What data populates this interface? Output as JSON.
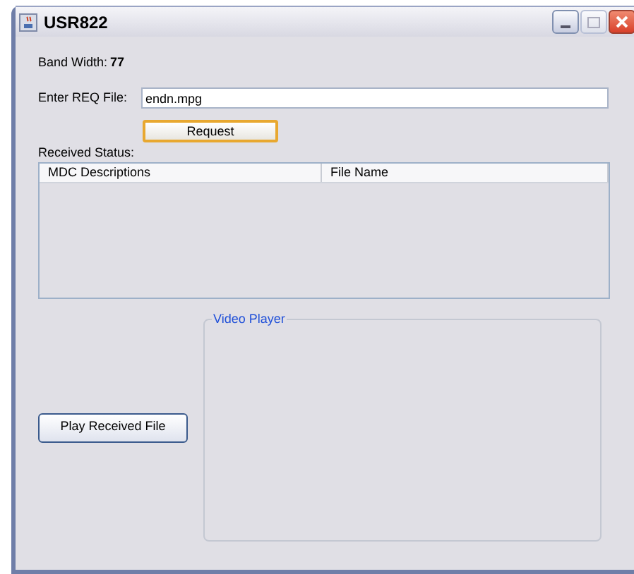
{
  "window": {
    "title": "USR822"
  },
  "bandwidth": {
    "label": "Band Width:",
    "value": "77"
  },
  "request_file": {
    "label": "Enter REQ File:",
    "value": "endn.mpg"
  },
  "request_button": {
    "label": "Request",
    "focused": true
  },
  "received_status": {
    "label": "Received Status:"
  },
  "table": {
    "columns": [
      "MDC Descriptions",
      "File Name"
    ]
  },
  "play_button": {
    "label": "Play Received File",
    "focused": false
  },
  "video_player": {
    "title": "Video Player"
  }
}
